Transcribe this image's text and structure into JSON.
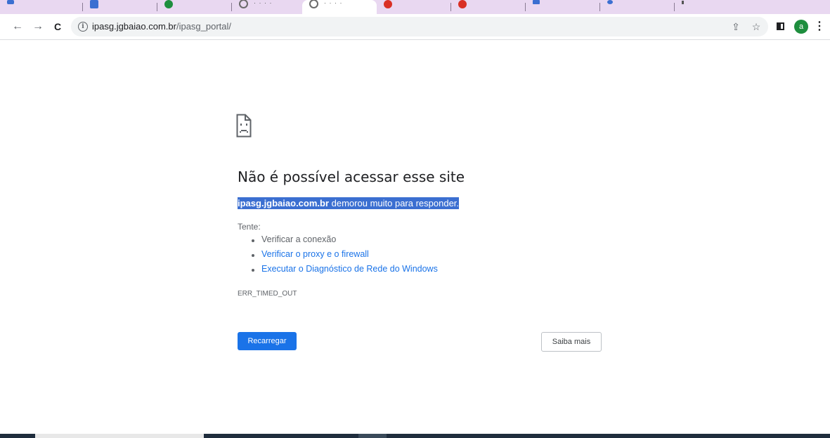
{
  "browser": {
    "tabs": [
      {
        "favicon_color": "#3b6fd1"
      },
      {
        "favicon_color": "#1e8e3e"
      },
      {
        "favicon_color": "#6a6a6a"
      },
      {
        "favicon_color": "#6a6a6a",
        "active": true
      },
      {
        "favicon_color": "#d93025"
      },
      {
        "favicon_color": "#d93025"
      },
      {
        "favicon_color": "#3b6fd1"
      },
      {
        "favicon_color": "#3b6fd1"
      }
    ],
    "url_host": "ipasg.jgbaiao.com.br",
    "url_path": "/ipasg_portal/",
    "nav": {
      "back": "←",
      "forward": "→",
      "reload": "C"
    },
    "omnibox_icons": {
      "share": "⇪",
      "bookmark": "☆"
    },
    "avatar_letter": "a",
    "menu_icon": "⋮",
    "accent_color": "#1a73e8"
  },
  "error_page": {
    "title": "Não é possível acessar esse site",
    "summary_host": "ipasg.jgbaiao.com.br",
    "summary_text": " demorou muito para responder.",
    "suggestions_heading": "Tente:",
    "suggestions": [
      {
        "text": "Verificar a conexão",
        "link": false
      },
      {
        "text": "Verificar o proxy e o firewall",
        "link": true
      },
      {
        "text": "Executar o Diagnóstico de Rede do Windows",
        "link": true
      }
    ],
    "error_code": "ERR_TIMED_OUT",
    "reload_button": "Recarregar",
    "details_button": "Saiba mais"
  }
}
